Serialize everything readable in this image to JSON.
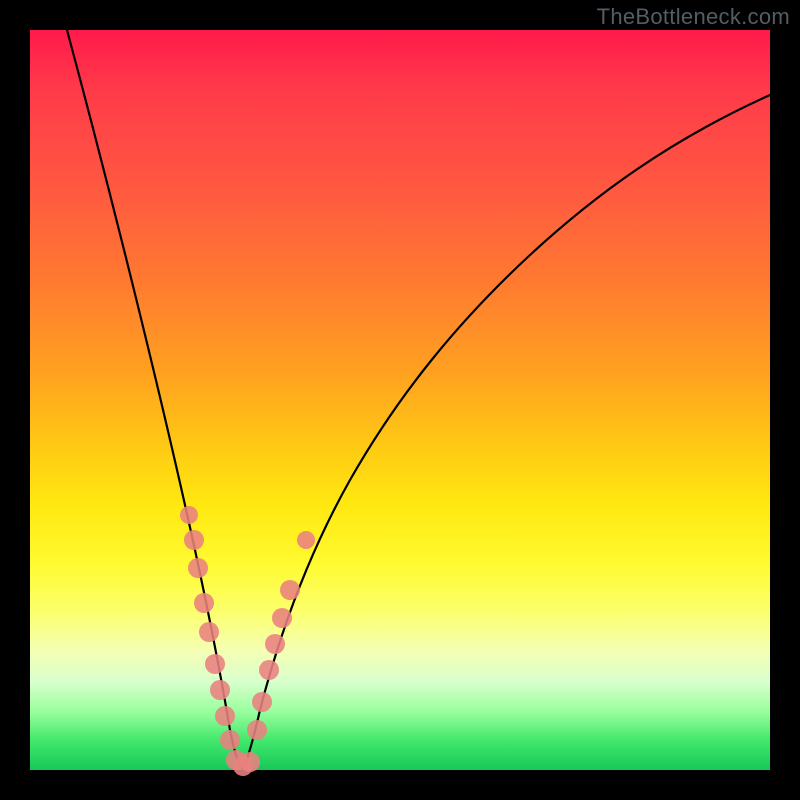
{
  "watermark": "TheBottleneck.com",
  "chart_data": {
    "type": "line",
    "title": "",
    "xlabel": "",
    "ylabel": "",
    "xlim": [
      0,
      100
    ],
    "ylim": [
      0,
      100
    ],
    "grid": false,
    "series": [
      {
        "name": "bottleneck-curve",
        "x": [
          5,
          8,
          11,
          14,
          17,
          20,
          22,
          24,
          25,
          26,
          27,
          28,
          29,
          30,
          32,
          34,
          37,
          41,
          46,
          52,
          58,
          65,
          73,
          82,
          92,
          100
        ],
        "y": [
          100,
          88,
          76,
          64,
          53,
          43,
          35,
          27,
          21,
          14,
          7,
          1,
          1,
          6,
          15,
          24,
          34,
          43,
          52,
          60,
          67,
          74,
          80,
          85,
          89,
          92
        ]
      }
    ],
    "clusters": [
      {
        "name": "left-branch-points",
        "x_approx": [
          21,
          22,
          22.5,
          23.5,
          24,
          25,
          25.5,
          26,
          27
        ],
        "y_approx": [
          36,
          32,
          27,
          22,
          18,
          14,
          11,
          8,
          4
        ]
      },
      {
        "name": "basin-points",
        "x_approx": [
          27.5,
          28,
          28.5,
          29
        ],
        "y_approx": [
          1,
          1,
          1,
          2
        ]
      },
      {
        "name": "right-branch-points",
        "x_approx": [
          30,
          30.8,
          31.8,
          32.6,
          33.5,
          34.5,
          36
        ],
        "y_approx": [
          8,
          12,
          17,
          20,
          24,
          28,
          34
        ]
      }
    ],
    "annotations": []
  }
}
